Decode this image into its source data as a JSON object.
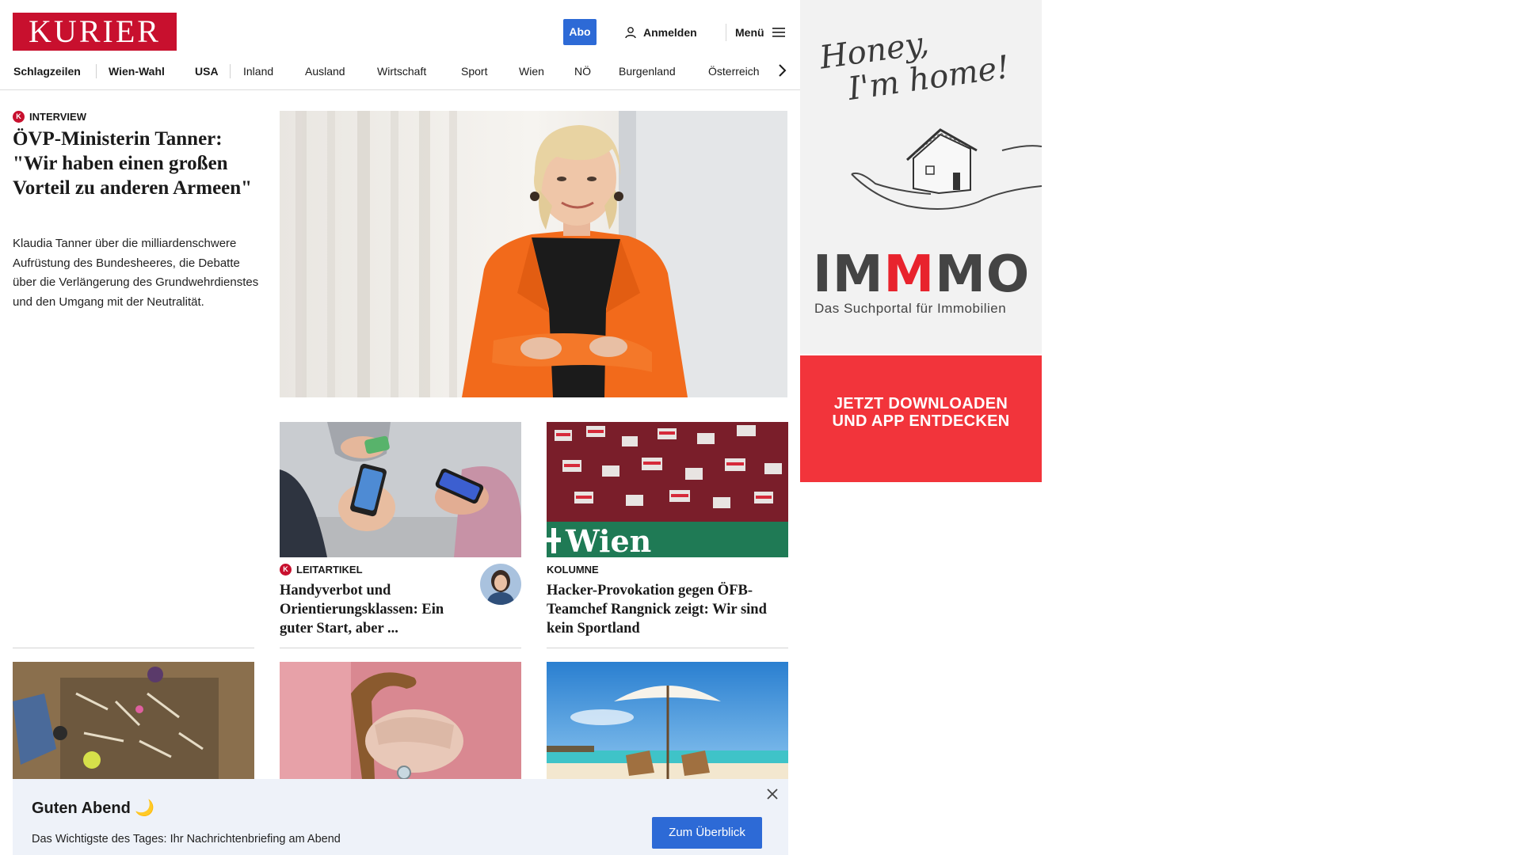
{
  "header": {
    "logo": "KURIER",
    "abo_label": "Abo",
    "login_label": "Anmelden",
    "menu_label": "Menü"
  },
  "nav": {
    "items": [
      "Schlagzeilen",
      "Wien-Wahl",
      "USA",
      "Inland",
      "Ausland",
      "Wirtschaft",
      "Sport",
      "Wien",
      "NÖ",
      "Burgenland",
      "Österreich"
    ]
  },
  "lead": {
    "kicker": "INTERVIEW",
    "badge": "K",
    "title": "ÖVP-Ministerin Tanner: \"Wir haben einen großen Vorteil zu anderen Armeen\"",
    "teaser": "Klaudia Tanner über die milliardenschwere Aufrüstung des Bundesheeres, die Debatte über die Verlängerung des Grundwehrdienstes und den Umgang mit der Neutralität."
  },
  "cards": [
    {
      "kicker": "LEITARTIKEL",
      "badge": "K",
      "title": "Handyverbot und Orientierungsklassen: Ein guter Start, aber ..."
    },
    {
      "kicker": "KOLUMNE",
      "title": "Hacker-Provokation gegen ÖFB-Teamchef Rangnick zeigt: Wir sind kein Sportland"
    }
  ],
  "ad": {
    "script_line1": "Honey,",
    "script_line2": "I'm home!",
    "brand_a": "IM",
    "brand_b": "M",
    "brand_c": "MO",
    "subline": "Das Suchportal für Immobilien",
    "cta_line1": "JETZT DOWNLOADEN",
    "cta_line2": "UND APP ENTDECKEN",
    "colors": {
      "red": "#e8232d",
      "bg": "#f2f2f2",
      "cta_bg": "#f2343b"
    }
  },
  "briefing": {
    "title": "Guten Abend 🌙",
    "text": "Das Wichtigste des Tages: Ihr Nachrichtenbriefing am Abend",
    "button": "Zum Überblick"
  },
  "colors": {
    "brand": "#c8102e",
    "accent": "#2d6ad6"
  }
}
